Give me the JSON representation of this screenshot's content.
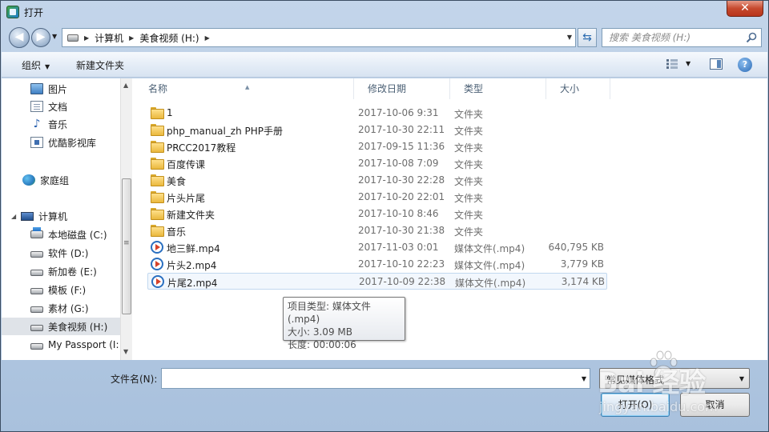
{
  "window": {
    "title": "打开",
    "close": "✕"
  },
  "address": {
    "crumbs": [
      "计算机",
      "美食视频 (H:)"
    ]
  },
  "search": {
    "placeholder": "搜索 美食视频 (H:)"
  },
  "toolbar": {
    "organize": "组织",
    "new_folder": "新建文件夹",
    "help": "?"
  },
  "nav": {
    "items": [
      {
        "label": "图片",
        "icon": "pictures-icon"
      },
      {
        "label": "文档",
        "icon": "documents-icon"
      },
      {
        "label": "音乐",
        "icon": "music-icon"
      },
      {
        "label": "优酷影视库",
        "icon": "video-library-icon"
      },
      {
        "label": "家庭组",
        "icon": "homegroup-icon"
      },
      {
        "label": "计算机",
        "icon": "computer-icon"
      },
      {
        "label": "本地磁盘 (C:)",
        "icon": "system-drive-icon"
      },
      {
        "label": "软件 (D:)",
        "icon": "drive-icon"
      },
      {
        "label": "新加卷 (E:)",
        "icon": "drive-icon"
      },
      {
        "label": "模板 (F:)",
        "icon": "drive-icon"
      },
      {
        "label": "素材 (G:)",
        "icon": "drive-icon"
      },
      {
        "label": "美食视频 (H:)",
        "icon": "drive-icon",
        "selected": true
      },
      {
        "label": "My Passport (I:",
        "icon": "drive-icon"
      }
    ]
  },
  "columns": {
    "name": "名称",
    "date": "修改日期",
    "type": "类型",
    "size": "大小"
  },
  "files": [
    {
      "name": "1",
      "date": "2017-10-06 9:31",
      "type": "文件夹",
      "size": "",
      "icon": "folder-icon"
    },
    {
      "name": "php_manual_zh PHP手册",
      "date": "2017-10-30 22:11",
      "type": "文件夹",
      "size": "",
      "icon": "folder-icon"
    },
    {
      "name": "PRCC2017教程",
      "date": "2017-09-15 11:36",
      "type": "文件夹",
      "size": "",
      "icon": "folder-icon"
    },
    {
      "name": "百度传课",
      "date": "2017-10-08 7:09",
      "type": "文件夹",
      "size": "",
      "icon": "folder-icon"
    },
    {
      "name": "美食",
      "date": "2017-10-30 22:28",
      "type": "文件夹",
      "size": "",
      "icon": "folder-icon"
    },
    {
      "name": "片头片尾",
      "date": "2017-10-20 22:01",
      "type": "文件夹",
      "size": "",
      "icon": "folder-icon"
    },
    {
      "name": "新建文件夹",
      "date": "2017-10-10 8:46",
      "type": "文件夹",
      "size": "",
      "icon": "folder-icon"
    },
    {
      "name": "音乐",
      "date": "2017-10-30 21:38",
      "type": "文件夹",
      "size": "",
      "icon": "folder-icon"
    },
    {
      "name": "地三鲜.mp4",
      "date": "2017-11-03 0:01",
      "type": "媒体文件(.mp4)",
      "size": "640,795 KB",
      "icon": "media-file-icon"
    },
    {
      "name": "片头2.mp4",
      "date": "2017-10-10 22:23",
      "type": "媒体文件(.mp4)",
      "size": "3,779 KB",
      "icon": "media-file-icon"
    },
    {
      "name": "片尾2.mp4",
      "date": "2017-10-09 22:38",
      "type": "媒体文件(.mp4)",
      "size": "3,174 KB",
      "icon": "media-file-icon",
      "hovered": true
    }
  ],
  "tooltip": {
    "line1": "项目类型: 媒体文件(.mp4)",
    "line2": "大小: 3.09 MB",
    "line3": "长度: 00:00:06"
  },
  "footer": {
    "filename_label": "文件名(N):",
    "filename_value": "",
    "filetype_value": "常见媒体格式",
    "open_label": "打开(O)",
    "cancel_label": "取消"
  },
  "watermark": {
    "brand": "Bai 经验",
    "url": "jingyan.baidu.com"
  }
}
